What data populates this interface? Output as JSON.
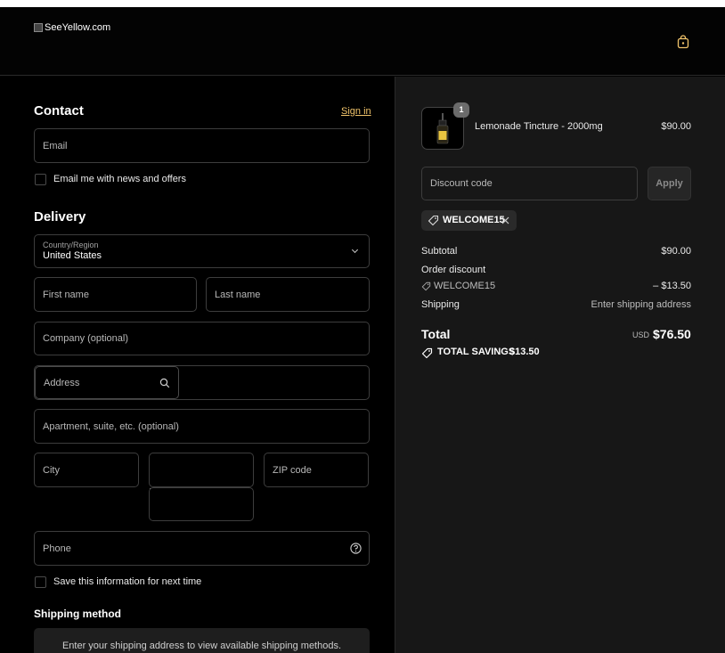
{
  "header": {
    "logo_alt": "SeeYellow.com",
    "cart_icon": "shopping-bag-icon"
  },
  "contact": {
    "heading": "Contact",
    "sign_in": "Sign in",
    "email_placeholder": "Email",
    "news_label": "Email me with news and offers"
  },
  "delivery": {
    "heading": "Delivery",
    "country_label": "Country/Region",
    "country_value": "United States",
    "first_name": "First name",
    "last_name": "Last name",
    "company": "Company (optional)",
    "address": "Address",
    "apartment": "Apartment, suite, etc. (optional)",
    "city": "City",
    "state": "",
    "zip": "ZIP code",
    "phone": "Phone",
    "save_label": "Save this information for next time"
  },
  "shipping": {
    "heading": "Shipping method",
    "message": "Enter your shipping address to view available shipping methods."
  },
  "summary": {
    "item_qty": "1",
    "item_name": "Lemonade Tincture - 2000mg",
    "item_price": "$90.00",
    "discount_placeholder": "Discount code",
    "apply_label": "Apply",
    "applied_code": "WELCOME15",
    "subtotal_label": "Subtotal",
    "subtotal_value": "$90.00",
    "order_discount_label": "Order discount",
    "discount_code": "WELCOME15",
    "discount_value": "– $13.50",
    "shipping_label": "Shipping",
    "shipping_value": "Enter shipping address",
    "total_label": "Total",
    "currency": "USD",
    "total_value": "$76.50",
    "savings_label": "TOTAL SAVINGS",
    "savings_value": "$13.50"
  },
  "colors": {
    "accent_link": "#f0c36a",
    "panel_bg": "#171717",
    "page_bg": "#000000"
  }
}
